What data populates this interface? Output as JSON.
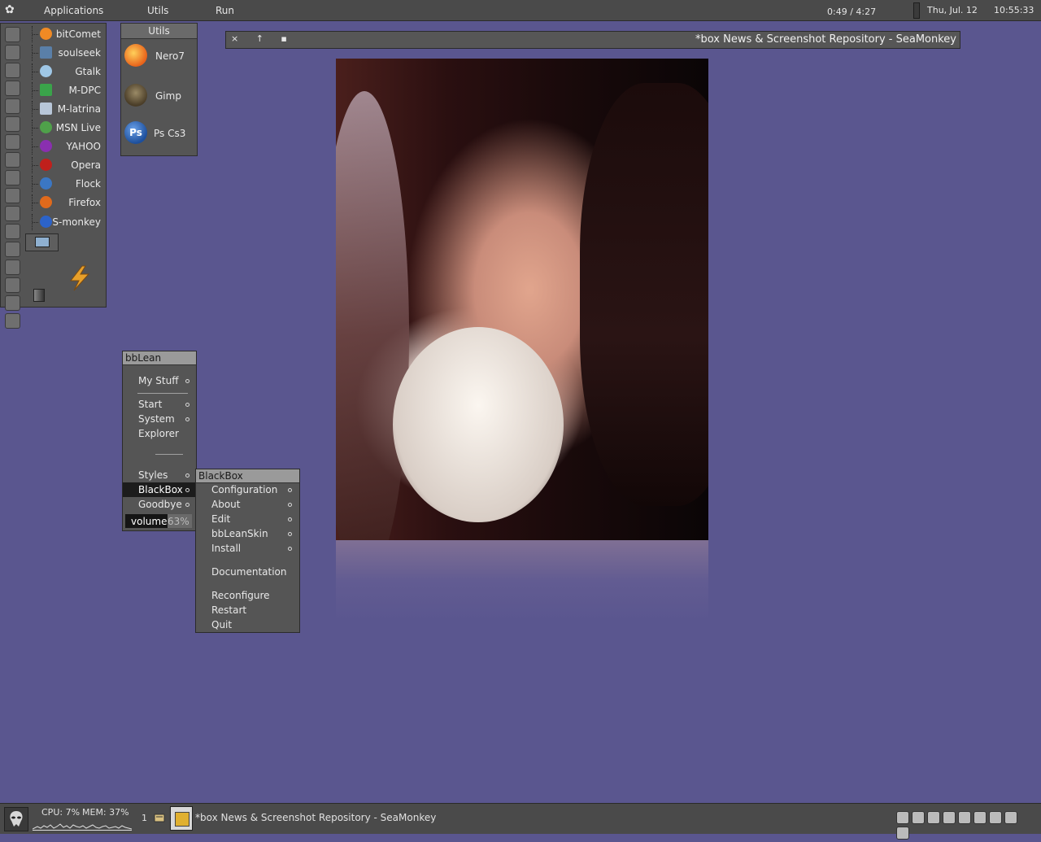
{
  "topbar": {
    "menus": [
      "Applications",
      "Utils",
      "Run"
    ],
    "media_time": "0:49 / 4:27",
    "date": "Thu, Jul. 12",
    "time": "10:55:33"
  },
  "launcher": {
    "apps": [
      {
        "label": "bitComet",
        "icon": "bitcomet-icon",
        "color": "#f08a24"
      },
      {
        "label": "soulseek",
        "icon": "soulseek-icon",
        "color": "#5a7fa8"
      },
      {
        "label": "Gtalk",
        "icon": "gtalk-icon",
        "color": "#9fc7e6"
      },
      {
        "label": "M-DPC",
        "icon": "mdpc-icon",
        "color": "#3aa34a"
      },
      {
        "label": "M-latrina",
        "icon": "mlatrina-icon",
        "color": "#b8c6d8"
      },
      {
        "label": "MSN Live",
        "icon": "msn-icon",
        "color": "#4fa14a"
      },
      {
        "label": "YAHOO",
        "icon": "yahoo-icon",
        "color": "#8a2fb0"
      },
      {
        "label": "Opera",
        "icon": "opera-icon",
        "color": "#c0201c"
      },
      {
        "label": "Flock",
        "icon": "flock-icon",
        "color": "#3b77c4"
      },
      {
        "label": "Firefox",
        "icon": "firefox-icon",
        "color": "#e06a1c"
      },
      {
        "label": "S-monkey",
        "icon": "seamonkey-icon",
        "color": "#2c63c9"
      }
    ]
  },
  "utils": {
    "title": "Utils",
    "items": [
      {
        "label": "Nero7",
        "icon": "nero-icon",
        "color": "#e8621a"
      },
      {
        "label": "Gimp",
        "icon": "gimp-icon",
        "color": "#6c5a3a"
      },
      {
        "label": "Ps Cs3",
        "icon": "photoshop-icon",
        "color": "#1d4f9c"
      }
    ]
  },
  "window": {
    "title": "*box News & Screenshot Repository - SeaMonkey",
    "buttons": "× ↑ ▪"
  },
  "bblean_menu": {
    "title": "bbLean",
    "items": [
      "My Stuff",
      "Start",
      "System",
      "Explorer",
      "Styles",
      "BlackBox",
      "Goodbye"
    ],
    "volume_label": "volume",
    "volume_value": "63%",
    "volume_level": 0.63
  },
  "blackbox_menu": {
    "title": "BlackBox",
    "items": [
      "Configuration",
      "About",
      "Edit",
      "bbLeanSkin",
      "Install",
      "Documentation",
      "Reconfigure",
      "Restart",
      "Quit"
    ]
  },
  "taskbar": {
    "cpu": "CPU: 7%",
    "mem": "MEM: 37%",
    "workspace": "1",
    "task_title": "*box News & Screenshot Repository - SeaMonkey"
  }
}
